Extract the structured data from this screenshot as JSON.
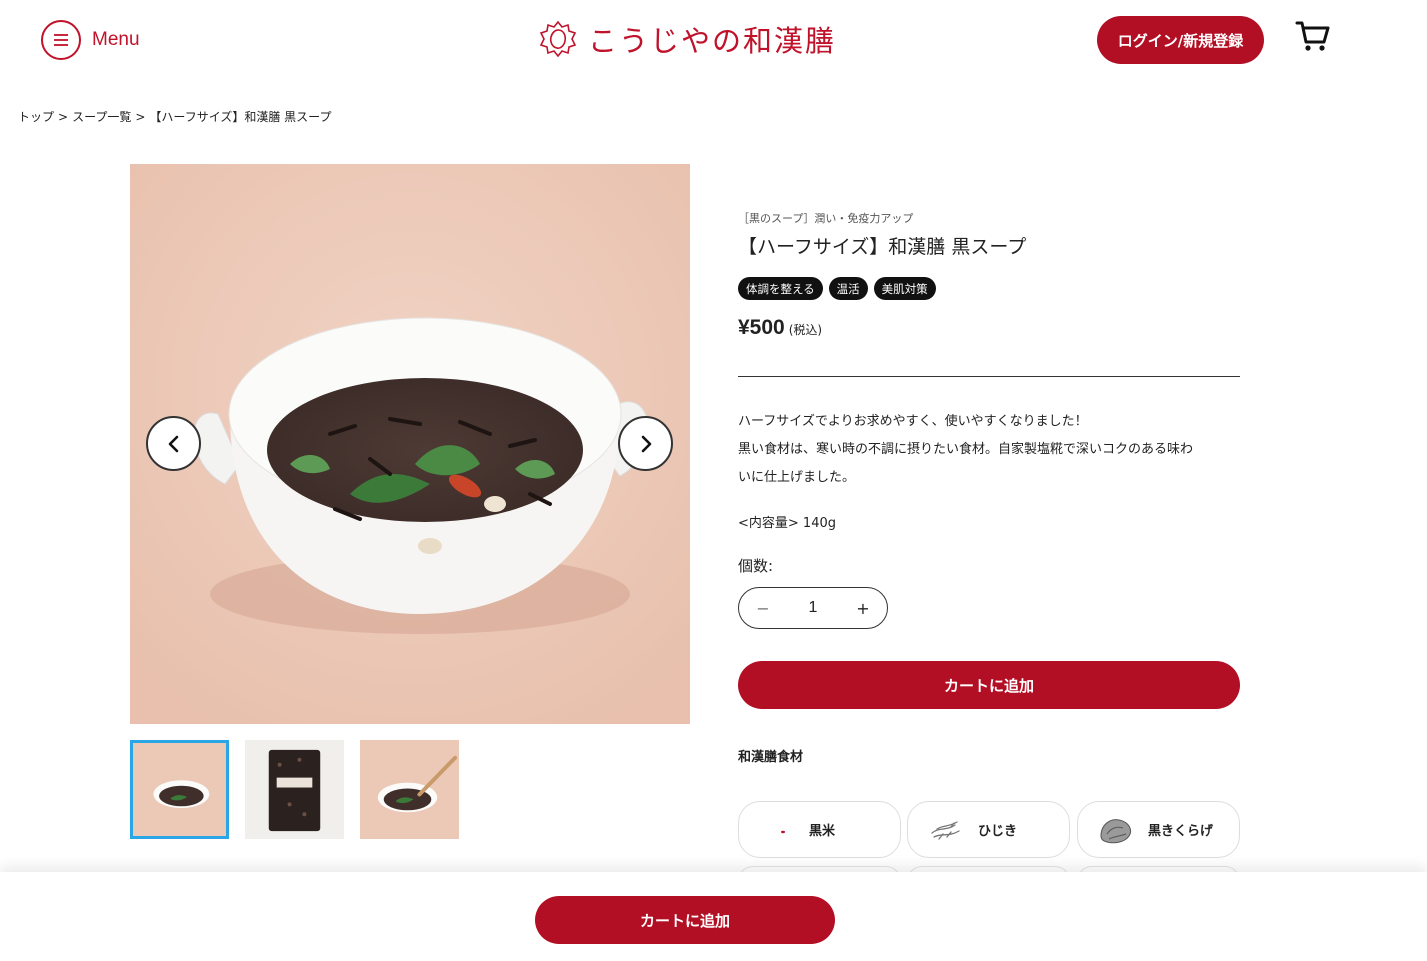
{
  "header": {
    "menu_label": "Menu",
    "logo_text": "こうじやの和漢膳",
    "login_label": "ログイン/新規登録"
  },
  "breadcrumb": {
    "items": [
      "トップ",
      "スープ一覧",
      "【ハーフサイズ】和漢膳 黒スープ"
    ],
    "separator": ">"
  },
  "product": {
    "category": "［黒のスープ］潤い・免疫力アップ",
    "title": "【ハーフサイズ】和漢膳 黒スープ",
    "tags": [
      "体調を整える",
      "温活",
      "美肌対策"
    ],
    "price": "¥500",
    "price_tax": "(税込)",
    "description_lines": [
      "ハーフサイズでよりお求めやすく、使いやすくなりました！",
      "黒い食材は、寒い時の不調に摂りたい食材。自家製塩糀で深いコクのある味わ",
      "いに仕上げました。"
    ],
    "volume": "<内容量> 140g",
    "quantity_label": "個数:",
    "quantity": "1",
    "add_to_cart": "カートに追加"
  },
  "gallery": {
    "active_index": 0,
    "thumbnail_count": 3
  },
  "ingredients": {
    "heading": "和漢膳食材",
    "items": [
      {
        "label": "黒米",
        "icon": "black-rice-icon"
      },
      {
        "label": "ひじき",
        "icon": "hijiki-icon"
      },
      {
        "label": "黒きくらげ",
        "icon": "wood-ear-icon"
      }
    ]
  },
  "sticky": {
    "add_to_cart": "カートに追加"
  },
  "colors": {
    "brand_red": "#b30f24",
    "thumb_active_border": "#2aa5e6",
    "image_background": "#ecc8b6"
  }
}
